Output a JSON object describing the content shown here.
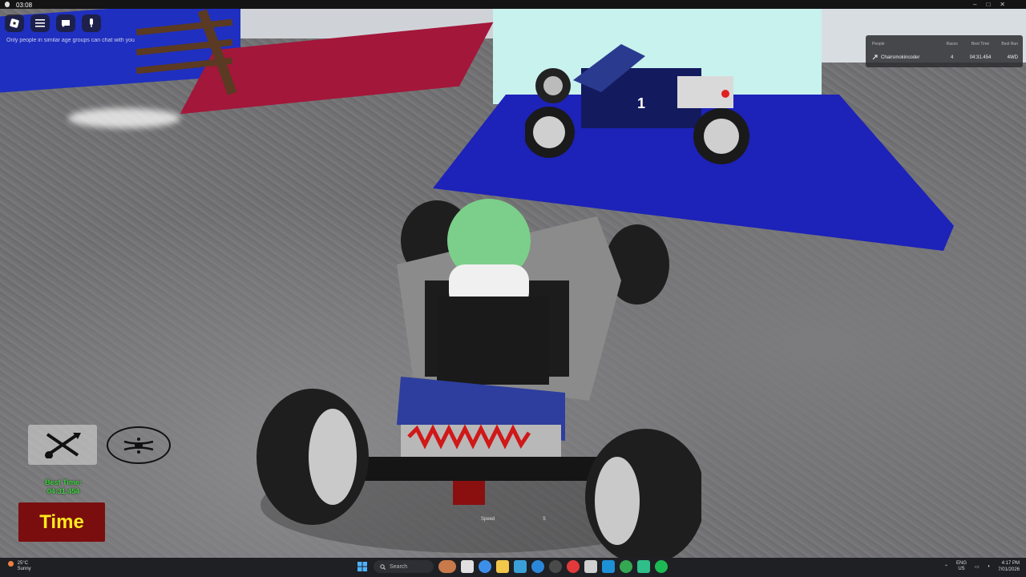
{
  "recording": {
    "elapsed": "03:08"
  },
  "roblox": {
    "chat_notice": "Only people in similar age groups can chat with you"
  },
  "leaderboard": {
    "columns": [
      "People",
      "Races",
      "Best Time",
      "Best Run"
    ],
    "rows": [
      {
        "player": "Chairsmokincoder",
        "races": "4",
        "best_time": "04:31.454",
        "best_run": "4WD"
      }
    ]
  },
  "hud": {
    "best_time_label": "Best Time:",
    "best_time_value": "04:31.454",
    "time_button": "Time",
    "speed_label": "Speed",
    "speed_value": "5"
  },
  "kart": {
    "number": "1"
  },
  "taskbar": {
    "weather_temp": "25°C",
    "weather_desc": "Sunny",
    "search_placeholder": "Search",
    "lang": "ENG",
    "region": "US",
    "time": "4:17 PM",
    "date": "7/01/2026"
  },
  "colors": {
    "time_button_bg": "#7a0e0e",
    "time_button_text": "#ffe91e",
    "best_time_green": "#3cd43c",
    "blue_platform": "#1d22b8",
    "red_pad": "#a3173a"
  }
}
